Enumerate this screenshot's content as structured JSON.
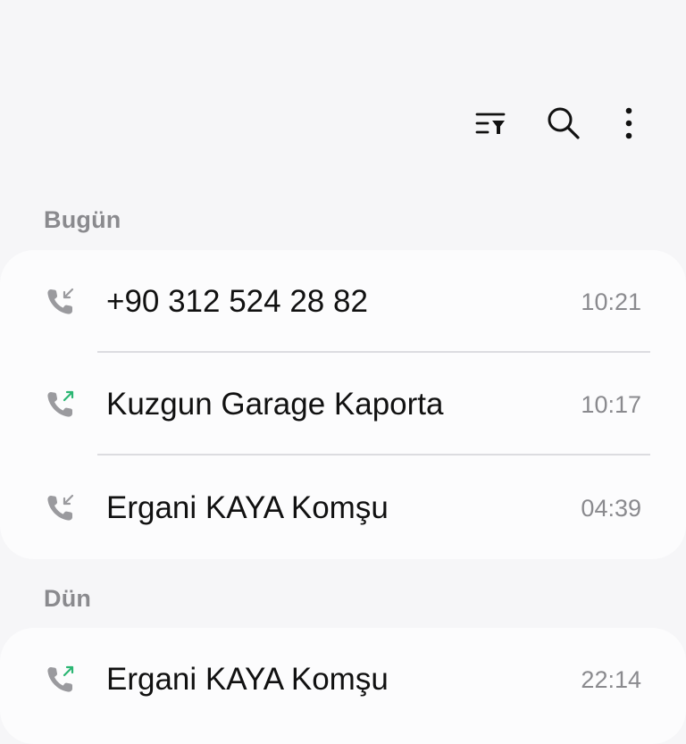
{
  "toolbar": {
    "filter_icon": "filter-list-icon",
    "search_icon": "search-icon",
    "more_icon": "more-vertical-icon"
  },
  "sections": [
    {
      "header": "Bugün",
      "calls": [
        {
          "name": "+90 312 524 28 82",
          "time": "10:21",
          "direction": "incoming",
          "icon": "incoming-call-icon"
        },
        {
          "name": "Kuzgun Garage Kaporta",
          "time": "10:17",
          "direction": "outgoing",
          "icon": "outgoing-call-icon"
        },
        {
          "name": "Ergani KAYA Komşu",
          "time": "04:39",
          "direction": "incoming",
          "icon": "incoming-call-icon"
        }
      ]
    },
    {
      "header": "Dün",
      "calls": [
        {
          "name": "Ergani KAYA Komşu",
          "time": "22:14",
          "direction": "outgoing",
          "icon": "outgoing-call-icon"
        }
      ]
    }
  ],
  "colors": {
    "background": "#f6f6f8",
    "card": "#fcfcfd",
    "header_text": "#8a8a8e",
    "primary_text": "#111111",
    "call_icon": "#9a9a9e",
    "incoming_arrow": "#9a9a9e",
    "outgoing_arrow": "#2bb673"
  }
}
